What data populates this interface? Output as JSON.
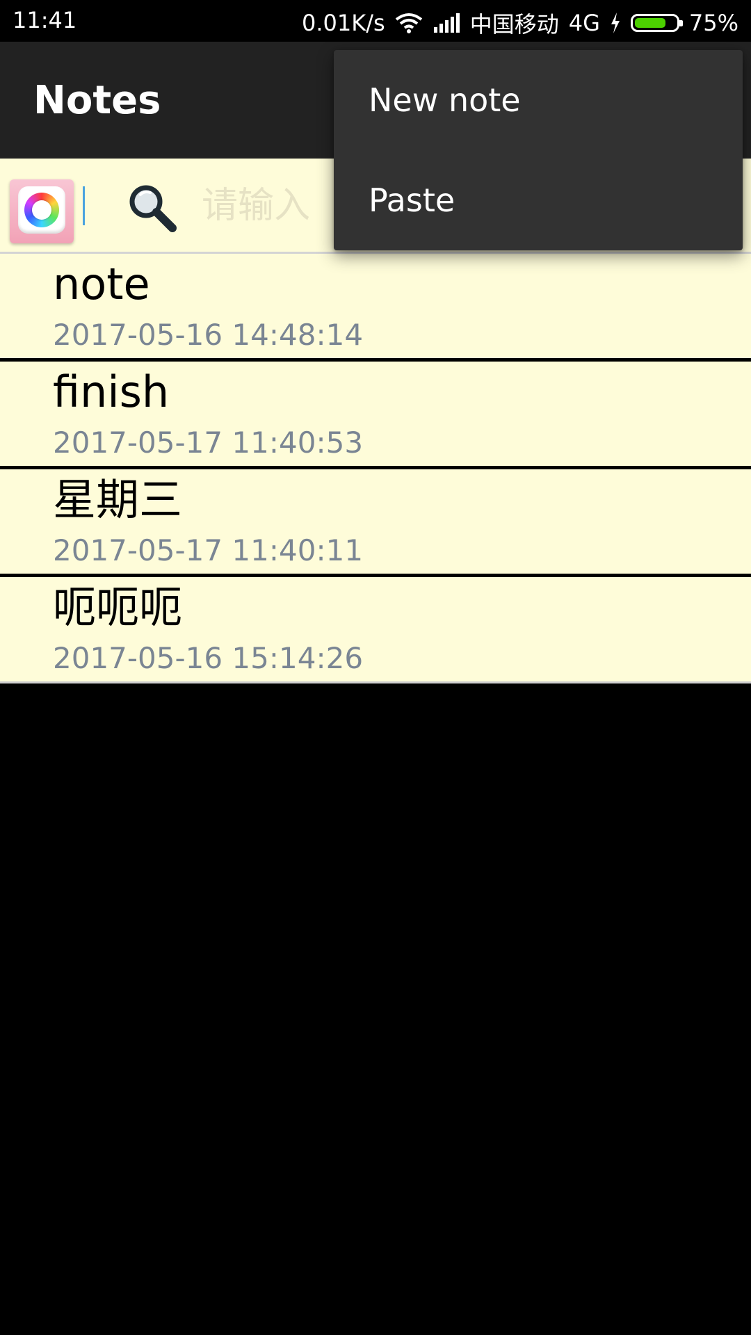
{
  "status_bar": {
    "time": "11:41",
    "network_speed": "0.01K/s",
    "carrier": "中国移动",
    "network_type": "4G",
    "battery_percent_label": "75%",
    "battery_level": 0.75,
    "battery_color": "#4cd100"
  },
  "action_bar": {
    "title": "Notes"
  },
  "search": {
    "palette_icon": "color-wheel-icon",
    "search_icon": "magnifier-icon",
    "placeholder": "请输入"
  },
  "notes": [
    {
      "title": "note",
      "date": "2017-05-16 14:48:14"
    },
    {
      "title": "finish",
      "date": "2017-05-17 11:40:53"
    },
    {
      "title": "星期三",
      "date": "2017-05-17 11:40:11"
    },
    {
      "title": "呃呃呃",
      "date": "2017-05-16 15:14:26"
    }
  ],
  "overflow_menu": {
    "items": [
      {
        "label": "New note"
      },
      {
        "label": "Paste"
      }
    ]
  },
  "colors": {
    "list_background": "#fefcd9",
    "action_bar": "#222222",
    "menu_background": "#323232",
    "date_text": "#7a8593"
  }
}
